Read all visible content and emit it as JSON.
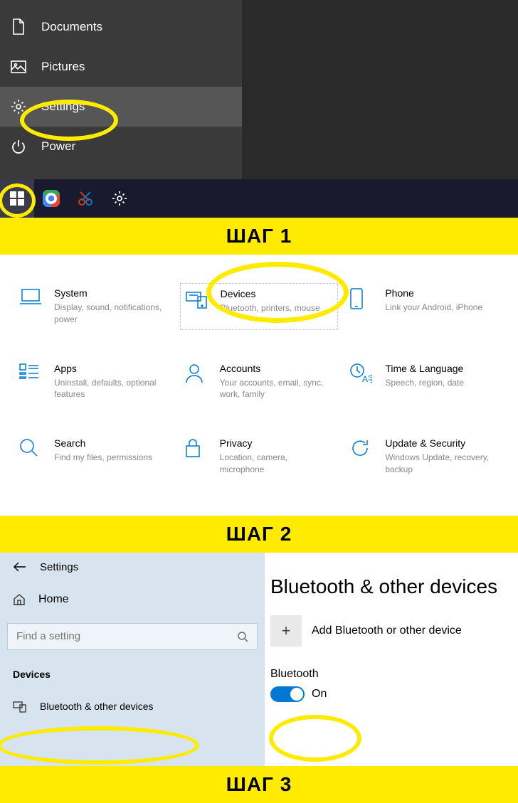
{
  "step_labels": [
    "ШАГ 1",
    "ШАГ 2",
    "ШАГ 3"
  ],
  "start_menu": {
    "items": [
      {
        "label": "Documents",
        "icon": "document-icon"
      },
      {
        "label": "Pictures",
        "icon": "picture-icon"
      },
      {
        "label": "Settings",
        "icon": "gear-icon",
        "active": true
      },
      {
        "label": "Power",
        "icon": "power-icon"
      }
    ]
  },
  "settings_grid": {
    "items": [
      {
        "title": "System",
        "sub": "Display, sound, notifications, power",
        "icon": "laptop-icon"
      },
      {
        "title": "Devices",
        "sub": "Bluetooth, printers, mouse",
        "icon": "devices-icon",
        "highlight": true
      },
      {
        "title": "Phone",
        "sub": "Link your Android, iPhone",
        "icon": "phone-icon"
      },
      {
        "title": "Apps",
        "sub": "Uninstall, defaults, optional features",
        "icon": "apps-icon"
      },
      {
        "title": "Accounts",
        "sub": "Your accounts, email, sync, work, family",
        "icon": "person-icon"
      },
      {
        "title": "Time & Language",
        "sub": "Speech, region, date",
        "icon": "time-lang-icon"
      },
      {
        "title": "Search",
        "sub": "Find my files, permissions",
        "icon": "search-icon"
      },
      {
        "title": "Privacy",
        "sub": "Location, camera, microphone",
        "icon": "lock-icon"
      },
      {
        "title": "Update & Security",
        "sub": "Windows Update, recovery, backup",
        "icon": "update-icon"
      }
    ]
  },
  "bluetooth": {
    "back_title": "Settings",
    "home": "Home",
    "search_placeholder": "Find a setting",
    "section": "Devices",
    "sub_item": "Bluetooth & other devices",
    "page_title": "Bluetooth & other devices",
    "add_label": "Add Bluetooth or other device",
    "toggle_label": "Bluetooth",
    "toggle_state": "On"
  }
}
